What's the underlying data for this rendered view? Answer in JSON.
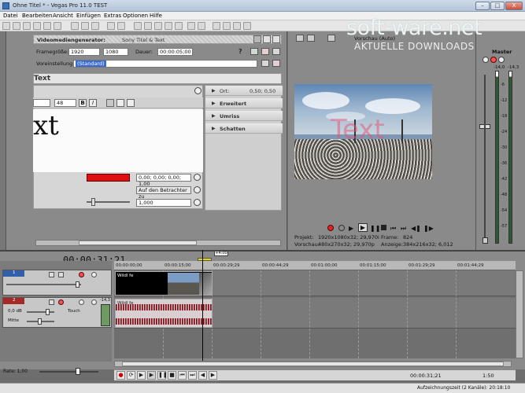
{
  "window": {
    "title": "Ohne Titel * - Vegas Pro 11.0 TEST",
    "min": "–",
    "max": "□",
    "close": "X"
  },
  "menu": [
    "Datei",
    "Bearbeiten",
    "Ansicht",
    "Einfügen",
    "Extras",
    "Optionen",
    "Hilfe"
  ],
  "watermark": {
    "main": "soft-ware.net",
    "sub": "AKTUELLE DOWNLOADS"
  },
  "generator": {
    "header_label": "Videomediengenerator:",
    "header_value": "Sony Titel & Text",
    "frame_label": "Framegröße:",
    "frame_w": "1920",
    "frame_h": "1080",
    "duration_label": "Dauer:",
    "duration": "00:00:05;00",
    "preset_label": "Voreinstellung:",
    "preset": "(Standard)"
  },
  "text_editor": {
    "title": "Text",
    "font_size": "48",
    "bold": "B",
    "italic": "I",
    "preview_text": "xt",
    "color_value": "0,00; 0,00; 0,00; 1,00",
    "anchor": "Auf den Betrachter zu",
    "scale": "1,000"
  },
  "properties": {
    "ort_label": "Ort:",
    "ort_value": "0,50; 0,50",
    "sections": [
      "Erweitert",
      "Umriss",
      "Schatten"
    ]
  },
  "preview": {
    "quality": "Vorschau (Auto)",
    "project_label": "Projekt:",
    "project_value": "1920x1080x32; 29,970i",
    "frame_label": "Frame:",
    "frame_value": "824",
    "vorschau_label": "Vorschau:",
    "vorschau_value": "480x270x32; 29,970p",
    "anzeige_label": "Anzeige:",
    "anzeige_value": "384x216x32; 6,012",
    "overlay_text": "Text"
  },
  "master": {
    "title": "Master",
    "scale": [
      "-6",
      "-12",
      "-18",
      "-24",
      "-30",
      "-36",
      "-42",
      "-48",
      "-54",
      "-57"
    ],
    "peak_l": "-14,0",
    "peak_r": "-14,3"
  },
  "timeline": {
    "timecode": "00:00:31;21",
    "marker": "+4:00",
    "ruler": [
      "00:00:00;00",
      "00:00:15;00",
      "00:00:29;29",
      "00:00:44;29",
      "00:01:00;00",
      "00:01:15;00",
      "00:01:29;29",
      "00:01:44;29"
    ],
    "video_clip": "Wildl fe",
    "audio_clip": "Wildl fe",
    "video_track_num": "1",
    "audio_track_num": "2",
    "audio_vol": "0,0 dB",
    "audio_pan": "Mitte",
    "touch": "Touch",
    "audio_level": "-14,3",
    "rate": "Rate: 1,00",
    "transport_time": "00:00:31;21",
    "status": "Aufzeichnungszeit (2 Kanäle): 20:18:10",
    "zoom_value": "1:50"
  }
}
